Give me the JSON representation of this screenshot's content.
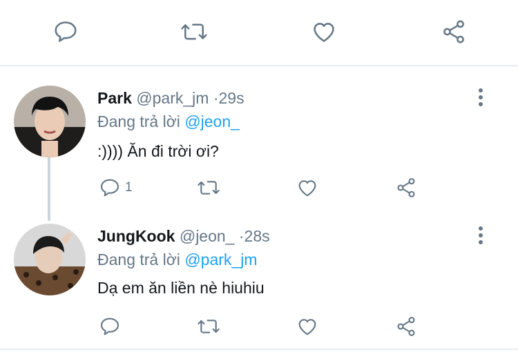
{
  "top_actions": {
    "reply_icon": "reply-icon",
    "retweet_icon": "retweet-icon",
    "like_icon": "like-icon",
    "share_icon": "share-icon"
  },
  "replies": [
    {
      "display_name": "Park",
      "handle": "@park_jm",
      "separator": "·",
      "time": "29s",
      "replying_prefix": "Đang trả lời",
      "replying_to": "@jeon_",
      "text": ":)))) Ăn đi trời ơi?",
      "reply_count": "1"
    },
    {
      "display_name": "JungKook",
      "handle": "@jeon_",
      "separator": "·",
      "time": "28s",
      "replying_prefix": "Đang trả lời",
      "replying_to": "@park_jm",
      "text": "Dạ em ăn liền nè hiuhiu",
      "reply_count": ""
    }
  ],
  "colors": {
    "text": "#14171a",
    "muted": "#657786",
    "link": "#1da1f2",
    "divider": "#e6ecf0",
    "thread_line": "#ccd6dd"
  }
}
